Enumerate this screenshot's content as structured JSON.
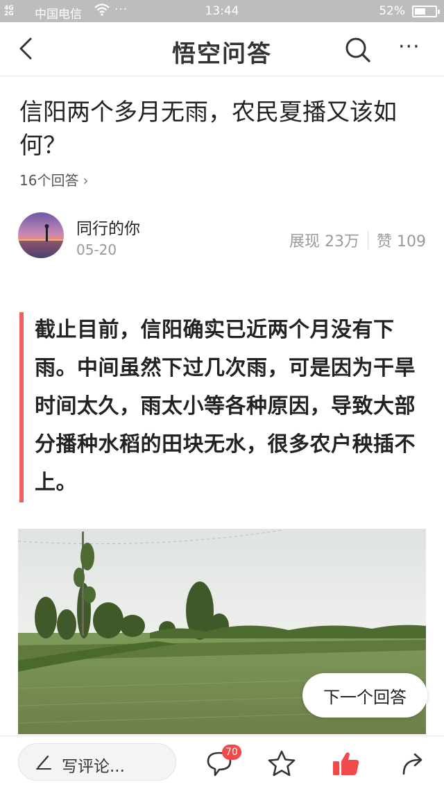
{
  "status_bar": {
    "signal_top": "4G",
    "signal_bottom": "2G",
    "carrier": "中国电信",
    "dots": "···",
    "time": "13:44",
    "battery": "52%",
    "battery_level": 0.52
  },
  "nav": {
    "title": "悟空问答",
    "more": "···"
  },
  "question": {
    "title": "信阳两个多月无雨，农民夏播又该如何？",
    "answer_count": "16个回答"
  },
  "author": {
    "name": "同行的你",
    "date": "05-20",
    "views": "展现 23万",
    "likes": "赞 109"
  },
  "answer": {
    "quote": "截止目前，信阳确实已近两个月没有下雨。中间虽然下过几次雨，可是因为干旱时间太久，雨太小等各种原因，导致大部分播种水稻的田块无水，很多农户秧插不上。"
  },
  "next_answer": "下一个回答",
  "bottom_bar": {
    "comment_placeholder": "写评论...",
    "comment_count": "70"
  },
  "colors": {
    "accent_red": "#f25f5f",
    "like_red": "#f04a4a",
    "status_bar": "#bdbdbd"
  }
}
